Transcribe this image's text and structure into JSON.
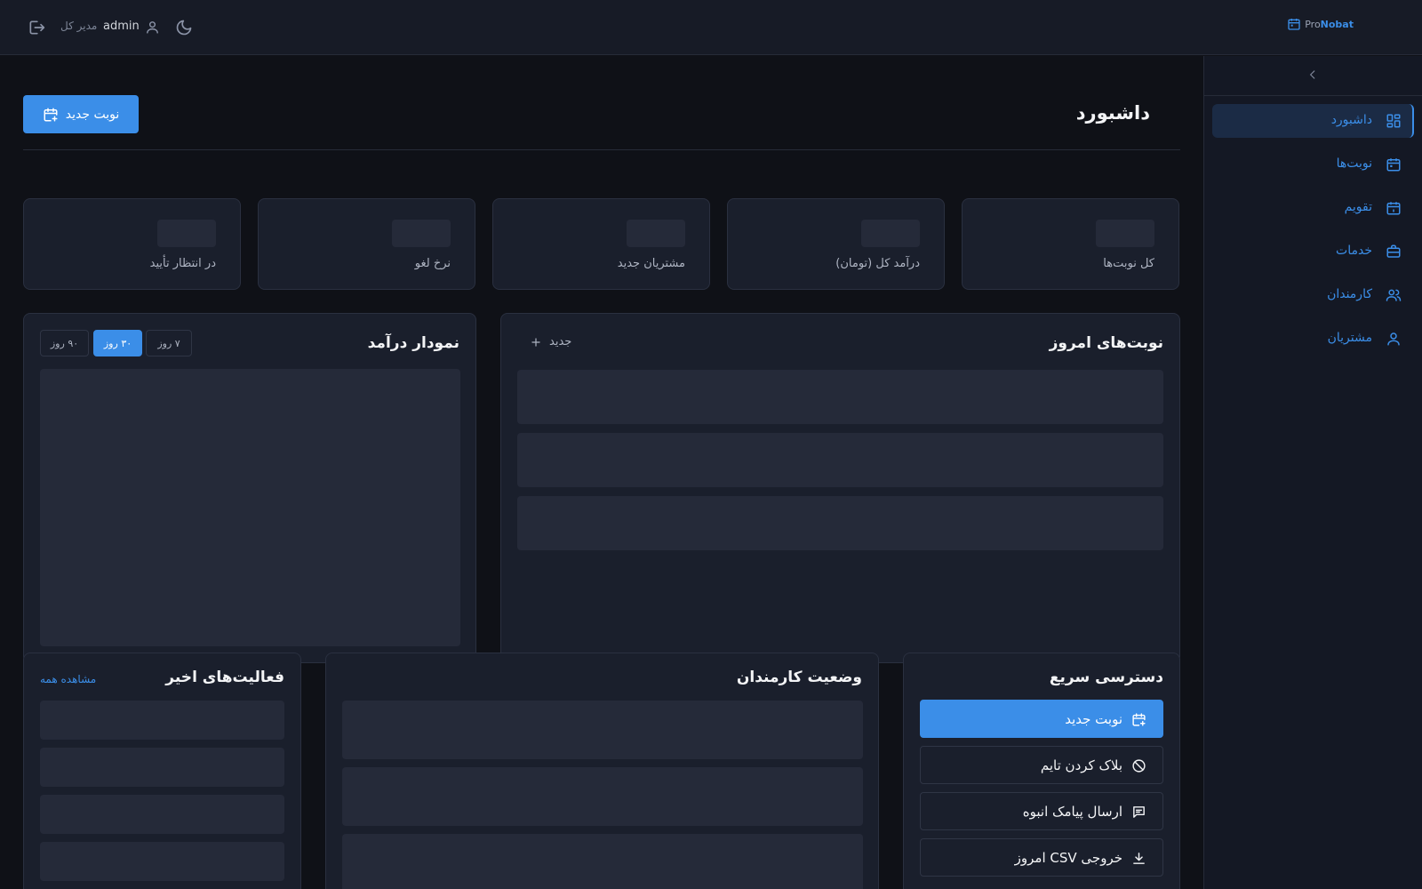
{
  "topbar": {
    "brand_pro": "Pro",
    "brand_nobat": "Nobat",
    "username": "admin",
    "role": "مدیر کل"
  },
  "sidebar": {
    "items": [
      {
        "label": "داشبورد",
        "icon": "dashboard-icon",
        "active": true
      },
      {
        "label": "نوبت‌ها",
        "icon": "calendar-icon",
        "active": false
      },
      {
        "label": "تقویم",
        "icon": "calendar-day-icon",
        "active": false
      },
      {
        "label": "خدمات",
        "icon": "briefcase-icon",
        "active": false
      },
      {
        "label": "کارمندان",
        "icon": "users-icon",
        "active": false
      },
      {
        "label": "مشتریان",
        "icon": "user-icon",
        "active": false
      }
    ]
  },
  "header": {
    "title": "داشبورد",
    "new_button_label": "نوبت جدید"
  },
  "stats": [
    {
      "label": "کل نوبت‌ها"
    },
    {
      "label": "درآمد کل (تومان)"
    },
    {
      "label": "مشتریان جدید"
    },
    {
      "label": "نرخ لغو"
    },
    {
      "label": "در انتظار تأیید"
    }
  ],
  "today": {
    "title": "نوبت‌های امروز",
    "add_label": "جدید"
  },
  "revenue": {
    "title": "نمودار درآمد",
    "ranges": [
      {
        "label": "۷ روز",
        "active": false
      },
      {
        "label": "۳۰ روز",
        "active": true
      },
      {
        "label": "۹۰ روز",
        "active": false
      }
    ]
  },
  "quick": {
    "title": "دسترسی سریع",
    "actions": [
      {
        "label": "نوبت جدید",
        "icon": "calendar-plus-icon",
        "primary": true
      },
      {
        "label": "بلاک کردن تایم",
        "icon": "block-icon",
        "primary": false
      },
      {
        "label": "ارسال پیامک انبوه",
        "icon": "message-icon",
        "primary": false
      },
      {
        "label": "خروجی CSV امروز",
        "icon": "download-icon",
        "primary": false
      }
    ]
  },
  "staff": {
    "title": "وضعیت کارمندان"
  },
  "activity": {
    "title": "فعالیت‌های اخیر",
    "see_all": "مشاهده همه"
  },
  "colors": {
    "accent": "#3b8ee8",
    "background": "#0f1117",
    "card": "#1a1f2c",
    "skeleton": "#252a39"
  }
}
